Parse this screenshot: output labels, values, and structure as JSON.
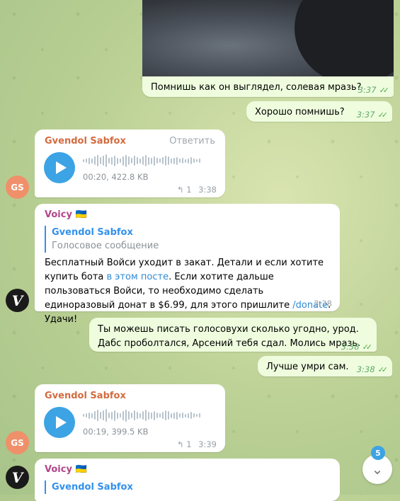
{
  "colors": {
    "accent": "#3ca3e4",
    "sender_gs": "#d36b3f",
    "sender_voicy": "#b2468a",
    "out_bubble": "#effdde"
  },
  "messages": {
    "m1": {
      "text": "Помнишь как он выглядел, солевая мразь?",
      "time": "3:37"
    },
    "m2": {
      "text": "Хорошо помнишь?",
      "time": "3:37"
    },
    "m3": {
      "sender": "Gvendol Sabfox",
      "reply_label": "Ответить",
      "duration": "00:20, 422.8 KB",
      "replies": "1",
      "time": "3:38"
    },
    "m4": {
      "sender": "Voicy",
      "flag": "🇺🇦",
      "quote_sender": "Gvendol Sabfox",
      "quote_text": "Голосовое сообщение",
      "text_a": "Бесплатный Войси уходит в закат. Детали и если хотите купить бота ",
      "link1": "в этом посте",
      "text_b": ". Если хотите дальше пользоваться Войси, то необходимо сделать единоразовый донат в $6.99, для этого пришлите ",
      "link2": "/donate",
      "text_c": ". Удачи!",
      "time": "3:38"
    },
    "m5": {
      "text": "Ты можешь писать голосовухи сколько угодно, урод. Дабс проболтался, Арсений тебя сдал. Молись мразь.",
      "time": "3:38"
    },
    "m6": {
      "text": "Лучше умри сам.",
      "time": "3:38"
    },
    "m7": {
      "sender": "Gvendol Sabfox",
      "duration": "00:19, 399.5 KB",
      "replies": "1",
      "time": "3:39"
    },
    "m8": {
      "sender": "Voicy",
      "flag": "🇺🇦",
      "quote_sender": "Gvendol Sabfox"
    }
  },
  "avatars": {
    "gs": "GS",
    "voicy": "V"
  },
  "unread_badge": "5"
}
